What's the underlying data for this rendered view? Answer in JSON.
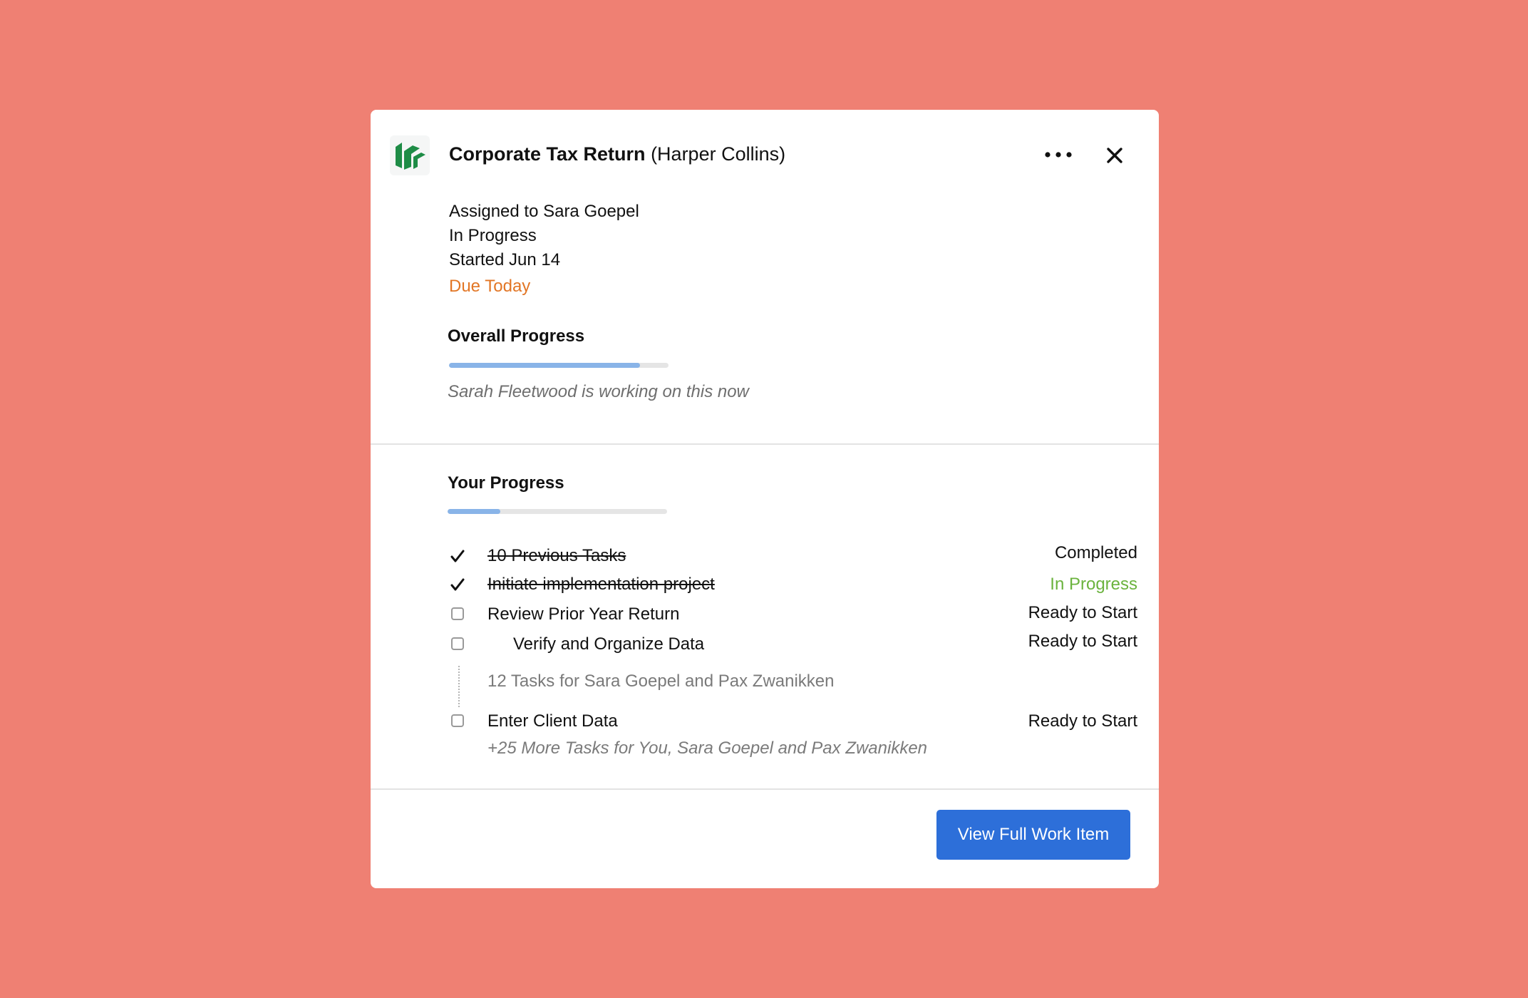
{
  "header": {
    "title": "Corporate Tax Return",
    "client": "(Harper Collins)",
    "more_icon": "more-horizontal-icon",
    "close_icon": "close-icon",
    "logo_color": "#1E8C46"
  },
  "meta": {
    "assigned": "Assigned to Sara Goepel",
    "status": "In Progress",
    "started": "Started Jun 14",
    "due": "Due Today",
    "due_color": "#E27625"
  },
  "overall_progress": {
    "heading": "Overall Progress",
    "fraction": 0.87,
    "note": "Sarah Fleetwood is working on this now"
  },
  "your_progress": {
    "heading": "Your Progress",
    "fraction": 0.24
  },
  "tasks": [
    {
      "label": "10 Previous Tasks",
      "status": "Completed",
      "done": true
    },
    {
      "label": "Initiate implementation project",
      "status": "In Progress",
      "done": true
    },
    {
      "label": "Review Prior Year Return",
      "status": "Ready to Start",
      "done": false
    },
    {
      "label": "Verify and Organize Data",
      "status": "Ready to Start",
      "done": false
    },
    {
      "label": "Enter Client Data",
      "status": "Ready to Start",
      "done": false
    }
  ],
  "group_note": "12 Tasks for Sara Goepel and Pax Zwanikken",
  "more_note": "+25 More Tasks for You, Sara Goepel and Pax Zwanikken",
  "footer": {
    "button_label": "View Full Work Item",
    "button_color": "#2D6FD9"
  },
  "colors": {
    "background": "#EF8073",
    "progress_fill": "#89B4E8",
    "status_in_progress": "#6BB33E"
  }
}
